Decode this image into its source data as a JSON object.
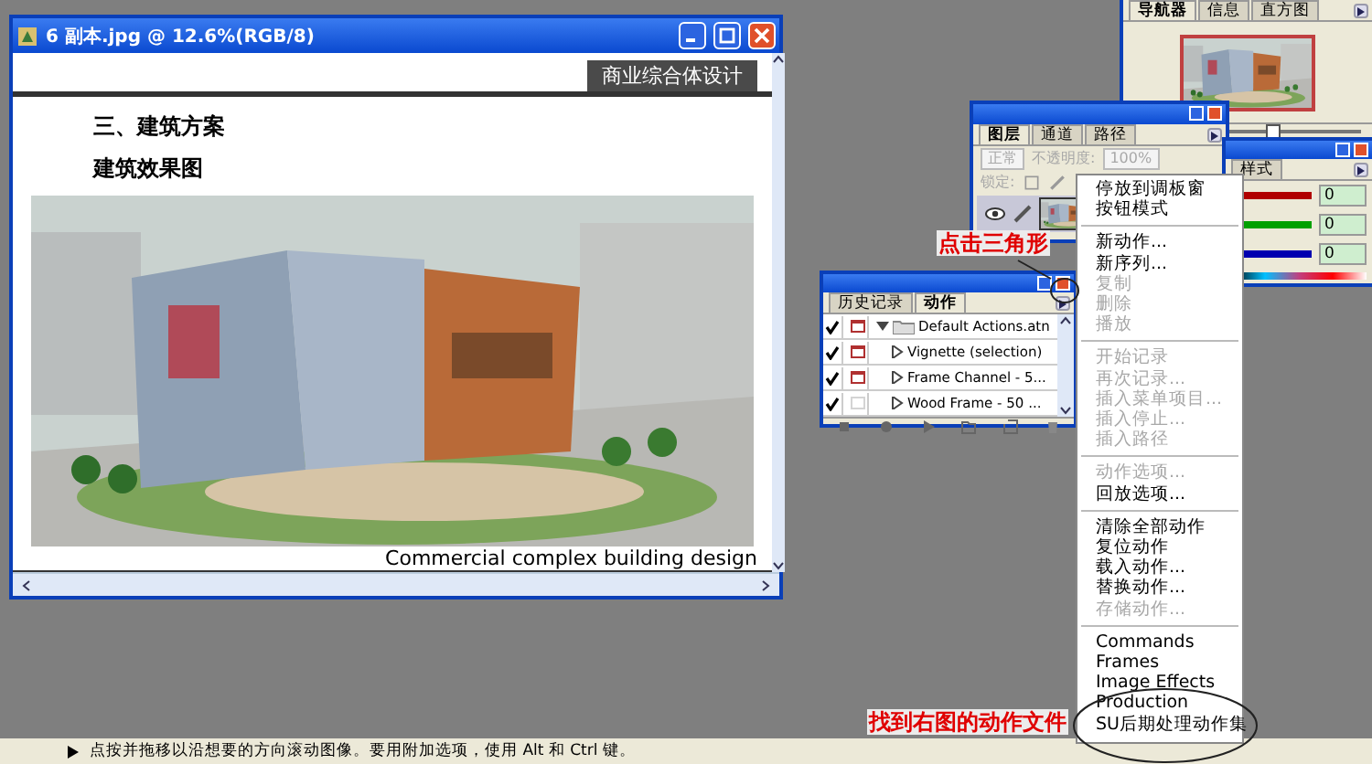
{
  "document_window": {
    "title": "6 副本.jpg @ 12.6%(RGB/8)",
    "header_label": "商业综合体设计",
    "heading": "三、建筑方案",
    "subheading": "建筑效果图",
    "caption": "Commercial complex building design"
  },
  "navigator_panel": {
    "tabs": [
      {
        "label": "导航器",
        "selected": true
      },
      {
        "label": "信息",
        "selected": false
      },
      {
        "label": "直方图",
        "selected": false
      }
    ]
  },
  "layers_panel": {
    "tabs": [
      {
        "label": "图层",
        "selected": true
      },
      {
        "label": "通道",
        "selected": false
      },
      {
        "label": "路径",
        "selected": false
      }
    ],
    "blend_mode": "正常",
    "opacity_label": "不透明度:",
    "opacity": "100%",
    "lock_label": "锁定:",
    "options_disabled": true
  },
  "color_panel": {
    "tab": "样式",
    "channels": [
      {
        "value": "0",
        "color": "#b00000"
      },
      {
        "value": "0",
        "color": "#00a000"
      },
      {
        "value": "0",
        "color": "#0000b0"
      }
    ]
  },
  "actions_panel": {
    "tabs": [
      {
        "label": "历史记录",
        "selected": false
      },
      {
        "label": "动作",
        "selected": true
      }
    ],
    "items": [
      {
        "label": "Default Actions.atn",
        "checked": true,
        "dialog": true,
        "expanded": true,
        "children": [
          {
            "label": "Vignette (selection)",
            "checked": true,
            "dialog": true,
            "expanded": false
          },
          {
            "label": "Frame Channel - 5...",
            "checked": true,
            "dialog": true,
            "expanded": false
          },
          {
            "label": "Wood Frame - 50 ...",
            "checked": true,
            "dialog": false,
            "expanded": false
          }
        ]
      }
    ]
  },
  "menu": {
    "items": [
      {
        "kind": "item",
        "label": "停放到调板窗",
        "disabled": false
      },
      {
        "kind": "item",
        "label": "按钮模式",
        "disabled": false
      },
      {
        "kind": "separator"
      },
      {
        "kind": "item",
        "label": "新动作...",
        "disabled": false
      },
      {
        "kind": "item",
        "label": "新序列...",
        "disabled": false
      },
      {
        "kind": "item",
        "label": "复制",
        "disabled": true
      },
      {
        "kind": "item",
        "label": "删除",
        "disabled": true
      },
      {
        "kind": "item",
        "label": "播放",
        "disabled": true
      },
      {
        "kind": "separator"
      },
      {
        "kind": "item",
        "label": "开始记录",
        "disabled": true
      },
      {
        "kind": "item",
        "label": "再次记录...",
        "disabled": true
      },
      {
        "kind": "item",
        "label": "插入菜单项目...",
        "disabled": true
      },
      {
        "kind": "item",
        "label": "插入停止...",
        "disabled": true
      },
      {
        "kind": "item",
        "label": "插入路径",
        "disabled": true
      },
      {
        "kind": "separator"
      },
      {
        "kind": "item",
        "label": "动作选项...",
        "disabled": true
      },
      {
        "kind": "item",
        "label": "回放选项...",
        "disabled": false
      },
      {
        "kind": "separator"
      },
      {
        "kind": "item",
        "label": "清除全部动作",
        "disabled": false
      },
      {
        "kind": "item",
        "label": "复位动作",
        "disabled": false
      },
      {
        "kind": "item",
        "label": "载入动作...",
        "disabled": false
      },
      {
        "kind": "item",
        "label": "替换动作...",
        "disabled": false
      },
      {
        "kind": "item",
        "label": "存储动作...",
        "disabled": true
      },
      {
        "kind": "separator"
      },
      {
        "kind": "item",
        "label": "Commands",
        "disabled": false
      },
      {
        "kind": "item",
        "label": "Frames",
        "disabled": false
      },
      {
        "kind": "item",
        "label": "Image Effects",
        "disabled": false
      },
      {
        "kind": "item",
        "label": "Production",
        "disabled": false
      },
      {
        "kind": "item",
        "label": "SU后期处理动作集",
        "disabled": false
      }
    ]
  },
  "annotations": [
    {
      "text": "点击三角形"
    },
    {
      "text": "找到右图的动作文件"
    }
  ],
  "status_bar": {
    "text": "点按并拖移以沿想要的方向滚动图像。要用附加选项，使用 Alt 和 Ctrl 键。"
  }
}
